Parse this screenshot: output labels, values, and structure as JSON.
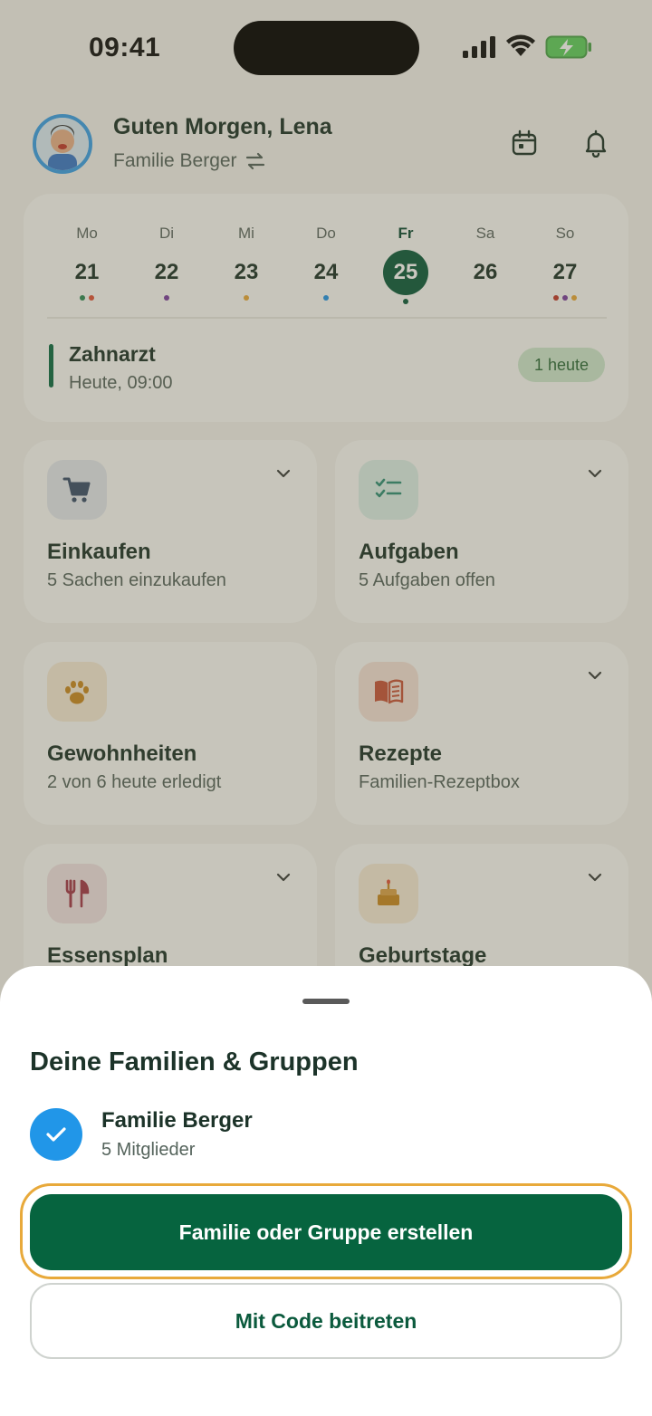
{
  "status_bar": {
    "time": "09:41"
  },
  "header": {
    "greeting": "Guten Morgen, Lena",
    "family": "Familie Berger"
  },
  "week": {
    "days": [
      {
        "name": "Mo",
        "num": "21",
        "dots": [
          "#2e8b57",
          "#e0543a"
        ]
      },
      {
        "name": "Di",
        "num": "22",
        "dots": [
          "#7b3fa0"
        ]
      },
      {
        "name": "Mi",
        "num": "23",
        "dots": [
          "#e8a93a"
        ]
      },
      {
        "name": "Do",
        "num": "24",
        "dots": [
          "#2196e8"
        ]
      },
      {
        "name": "Fr",
        "num": "25",
        "dots": [
          "#0b5a3d"
        ],
        "active": true
      },
      {
        "name": "Sa",
        "num": "26",
        "dots": []
      },
      {
        "name": "So",
        "num": "27",
        "dots": [
          "#c0392b",
          "#7b3fa0",
          "#e8a93a"
        ]
      }
    ],
    "event": {
      "title": "Zahnarzt",
      "time": "Heute, 09:00",
      "badge": "1 heute"
    }
  },
  "tiles": [
    {
      "id": "einkaufen",
      "title": "Einkaufen",
      "subtitle": "5 Sachen einzukaufen",
      "icon": "cart-icon",
      "icon_bg": "#e4e8ee",
      "chevron": true
    },
    {
      "id": "aufgaben",
      "title": "Aufgaben",
      "subtitle": "5 Aufgaben offen",
      "icon": "checklist-icon",
      "icon_bg": "#dcefe8",
      "chevron": true
    },
    {
      "id": "gewohnheiten",
      "title": "Gewohnheiten",
      "subtitle": "2 von 6 heute erledigt",
      "icon": "paw-icon",
      "icon_bg": "#f6ead6",
      "chevron": false
    },
    {
      "id": "rezepte",
      "title": "Rezepte",
      "subtitle": "Familien-Rezeptbox",
      "icon": "book-icon",
      "icon_bg": "#f5e2d8",
      "chevron": true
    },
    {
      "id": "essensplan",
      "title": "Essensplan",
      "subtitle": "",
      "icon": "cutlery-icon",
      "icon_bg": "#f1e2e4",
      "chevron": true
    },
    {
      "id": "geburtstage",
      "title": "Geburtstage",
      "subtitle": "",
      "icon": "cake-icon",
      "icon_bg": "#f6ead6",
      "chevron": true
    }
  ],
  "sheet": {
    "title": "Deine Familien & Gruppen",
    "group": {
      "name": "Familie Berger",
      "members": "5 Mitglieder",
      "selected": true
    },
    "primary_button": "Familie oder Gruppe erstellen",
    "secondary_button": "Mit Code beitreten"
  },
  "colors": {
    "brand": "#06643f",
    "check": "#2196e8",
    "focus": "#e8a93a"
  }
}
